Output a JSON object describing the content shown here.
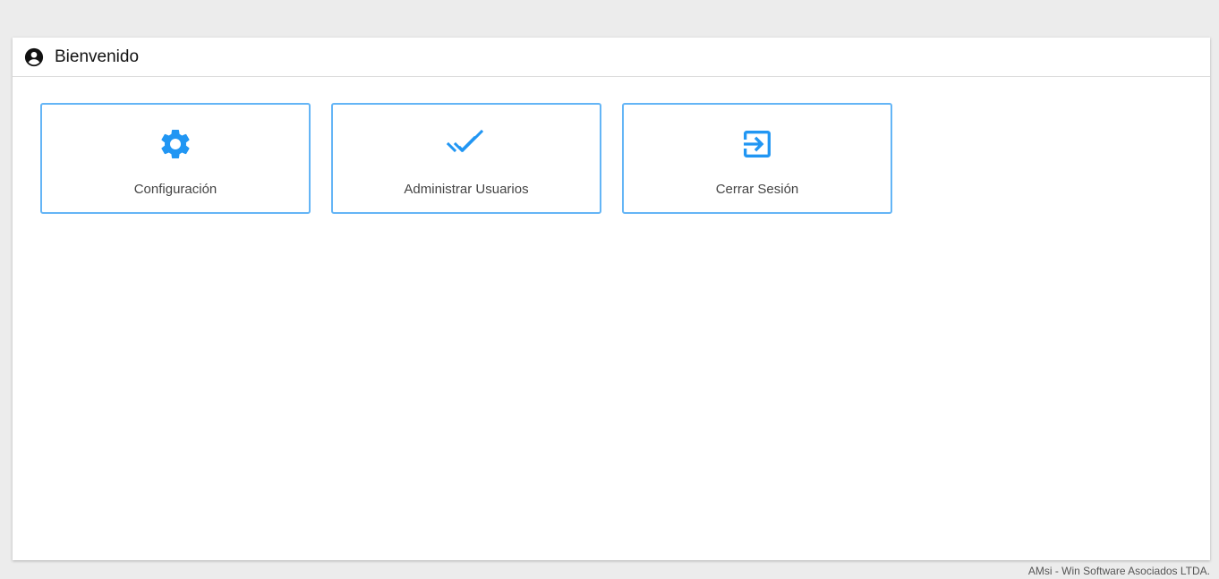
{
  "header": {
    "title": "Bienvenido",
    "icon": "account-circle-icon"
  },
  "tiles": [
    {
      "label": "Configuración",
      "icon": "gear-icon"
    },
    {
      "label": "Administrar Usuarios",
      "icon": "double-check-icon"
    },
    {
      "label": "Cerrar Sesión",
      "icon": "exit-icon"
    }
  ],
  "footer": {
    "text": "AMsi - Win Software Asociados LTDA."
  },
  "colors": {
    "accent": "#2196f3",
    "tile_border": "#64b5f6",
    "background": "#ececec"
  }
}
